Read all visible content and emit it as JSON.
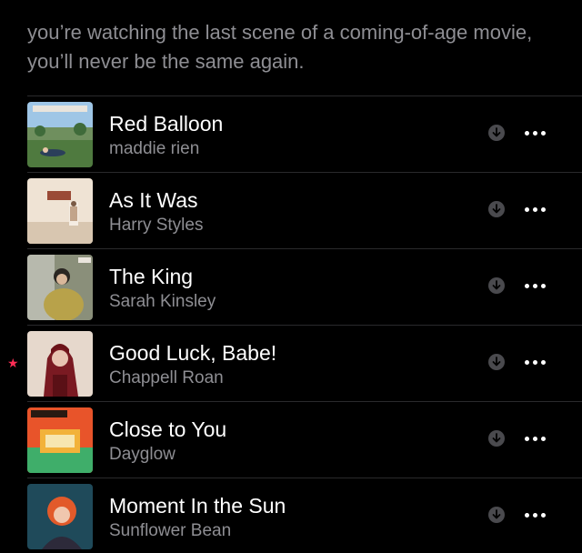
{
  "playlist": {
    "description": "you’re watching the last scene of a coming-of-age movie, you’ll never be the same again."
  },
  "colors": {
    "background": "#000000",
    "primary_text": "#ffffff",
    "secondary_text": "#8e8e93",
    "favorite_star": "#ff2d55",
    "download_badge": "#4a4a4e"
  },
  "icons": {
    "favorite": "star-icon",
    "download": "download-arrow-icon",
    "more": "ellipsis-icon"
  },
  "tracks": [
    {
      "title": "Red Balloon",
      "artist": "maddie rien",
      "favorite": false,
      "artwork_text": "RED BALLOON"
    },
    {
      "title": "As It Was",
      "artist": "Harry Styles",
      "favorite": false,
      "artwork_text": ""
    },
    {
      "title": "The King",
      "artist": "Sarah Kinsley",
      "favorite": false,
      "artwork_text": "THE KING"
    },
    {
      "title": "Good Luck, Babe!",
      "artist": "Chappell Roan",
      "favorite": true,
      "artwork_text": ""
    },
    {
      "title": "Close to You",
      "artist": "Dayglow",
      "favorite": false,
      "artwork_text": "DAYGLOW"
    },
    {
      "title": "Moment In the Sun",
      "artist": "Sunflower Bean",
      "favorite": false,
      "artwork_text": ""
    }
  ]
}
